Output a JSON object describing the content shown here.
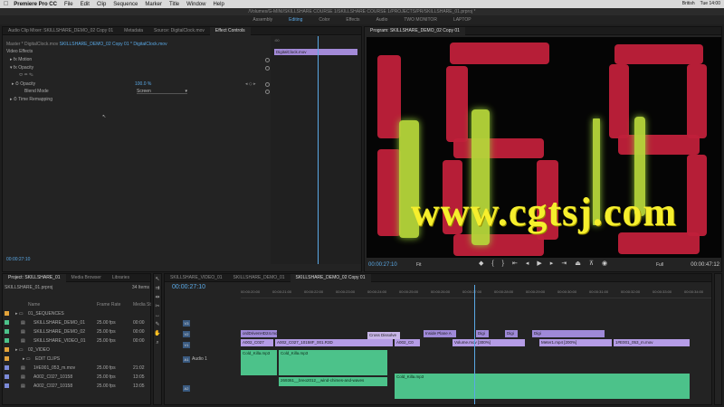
{
  "menubar": {
    "apple": "",
    "app": "Premiere Pro CC",
    "items": [
      "File",
      "Edit",
      "Clip",
      "Sequence",
      "Marker",
      "Title",
      "Window",
      "Help"
    ],
    "status": [
      "British",
      "Tue 14:00"
    ]
  },
  "title_path": "/Volumes/G-MINI/SKILLSHARE COURSE 1/SKILLSHARE COURSE 1/PROJECTS/PR/SKILLSHARE_01.prproj *",
  "workspaces": [
    "Assembly",
    "Editing",
    "Color",
    "Effects",
    "Audio",
    "TWO MONITOR",
    "LAPTOP"
  ],
  "active_workspace": "Editing",
  "effect_panel": {
    "tabs": [
      "Audio Clip Mixer: SKILLSHARE_DEMO_02 Copy 01",
      "Metadata",
      "Source: DigitalClock.mov",
      "Effect Controls"
    ],
    "master_prefix": "Master * DigitalClock.mov",
    "master_seq": "SKILLSHARE_DEMO_02 Copy 01 * DigitalClock.mov",
    "video_effects": "Video Effects",
    "motion": "Motion",
    "opacity": "Opacity",
    "opacity_param": "Opacity",
    "opacity_value": "100.0 %",
    "blend_mode": "Blend Mode",
    "blend_value": "Screen",
    "time_remap": "Time Remapping",
    "clip_label": "DigitalClock.mov",
    "ruler_tc": ":00",
    "timecode": "00:00:27:10"
  },
  "program": {
    "tab": "Program: SKILLSHARE_DEMO_02 Copy 01",
    "timecode": "00:00:27:10",
    "fit": "Fit",
    "quality": "Full",
    "duration": "00:00:47:12",
    "watermark": "www.cgtsj.com"
  },
  "project": {
    "tabs": [
      "Project: SKILLSHARE_01",
      "Media Browser",
      "Libraries"
    ],
    "file": "SKILLSHARE_01.prproj",
    "count": "34 Items",
    "headers": {
      "name": "Name",
      "frame_rate": "Frame Rate",
      "media": "Media St"
    },
    "rows": [
      {
        "name": "01_SEQUENCES",
        "fr": "",
        "ms": "",
        "color": "#e3a33a",
        "folder": true
      },
      {
        "name": "SKILLSHARE_DEMO_01",
        "fr": "25.00 fps",
        "ms": "00:00",
        "color": "#4cc28a"
      },
      {
        "name": "SKILLSHARE_DEMO_02",
        "fr": "25.00 fps",
        "ms": "00:00",
        "color": "#4cc28a"
      },
      {
        "name": "SKILLSHARE_VIDEO_01",
        "fr": "25.00 fps",
        "ms": "00:00",
        "color": "#4cc28a"
      },
      {
        "name": "02_VIDEO",
        "fr": "",
        "ms": "",
        "color": "#e3a33a",
        "folder": true
      },
      {
        "name": "EDIT CLIPS",
        "fr": "",
        "ms": "",
        "color": "#e3a33a",
        "folder": true
      },
      {
        "name": "1#E001_053_m.mov",
        "fr": "25.00 fps",
        "ms": "21:02",
        "color": "#7b8ad8"
      },
      {
        "name": "A002_C027_10158",
        "fr": "25.00 fps",
        "ms": "13:05",
        "color": "#7b8ad8"
      },
      {
        "name": "A002_C027_10158",
        "fr": "25.00 fps",
        "ms": "13:05",
        "color": "#7b8ad8"
      }
    ]
  },
  "timeline": {
    "tabs": [
      "SKILLSHARE_VIDEO_01",
      "SKILLSHARE_DEMO_01",
      "SKILLSHARE_DEMO_02 Copy 01"
    ],
    "timecode": "00:00:27:10",
    "ruler": [
      "00:00:20:00",
      "00:00:21:00",
      "00:00:22:00",
      "00:00:23:00",
      "00:00:24:00",
      "00:00:25:00",
      "00:00:26:00",
      "00:00:27:00",
      "00:00:28:00",
      "00:00:29:00",
      "00:00:30:00",
      "00:00:31:00",
      "00:00:32:00",
      "00:00:33:00",
      "00:00:34:00"
    ],
    "tracks": [
      "V3",
      "V2",
      "V1",
      "A1",
      "A2"
    ],
    "clips": {
      "v3": [
        "ordDrivenHD24.mov",
        "Cross Dissolve",
        "Inside Plane A",
        "Digi",
        "Digi",
        "Digi"
      ],
      "v2": [
        "A002_C027",
        "A002_C027_10158F_001.R3D",
        "A002_C0",
        "Volume.mov [300%]",
        "Meter1.mp4 [200%]",
        "1#E001_053_m.mov"
      ],
      "v1": [
        "Cold_Killa.mp3",
        "Cold_Killa.mp3",
        "Cold_Killa.mp3"
      ],
      "a1_label": "Audio 1",
      "a2": [
        "269361__breo2012__wind-chimes-and-waves"
      ]
    }
  }
}
